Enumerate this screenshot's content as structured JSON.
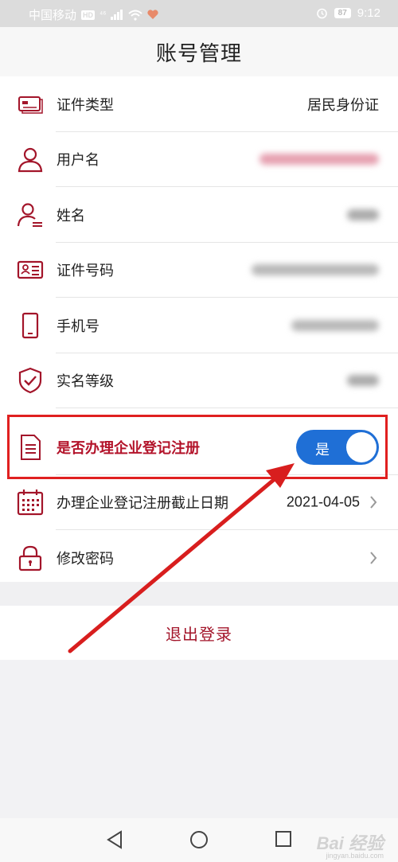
{
  "status_bar": {
    "carrier": "中国移动",
    "hd": "HD",
    "network": "⁴⁶",
    "battery": "87",
    "time": "9:12"
  },
  "header": {
    "title": "账号管理"
  },
  "rows": [
    {
      "label": "证件类型",
      "value": "居民身份证",
      "icon": "id-card-icon"
    },
    {
      "label": "用户名",
      "value": "",
      "icon": "user-icon"
    },
    {
      "label": "姓名",
      "value": "",
      "icon": "person-name-icon"
    },
    {
      "label": "证件号码",
      "value": "",
      "icon": "id-number-icon"
    },
    {
      "label": "手机号",
      "value": "",
      "icon": "phone-icon"
    },
    {
      "label": "实名等级",
      "value": "",
      "icon": "shield-check-icon"
    },
    {
      "label": "是否办理企业登记注册",
      "toggle_label": "是",
      "toggle_on": true,
      "icon": "document-icon"
    },
    {
      "label": "办理企业登记注册截止日期",
      "value": "2021-04-05",
      "icon": "calendar-icon"
    },
    {
      "label": "修改密码",
      "value": "",
      "icon": "lock-icon"
    }
  ],
  "logout": {
    "label": "退出登录"
  },
  "watermark": {
    "text": "Bai 经验",
    "sub": "jingyan.baidu.com"
  },
  "colors": {
    "accent_red": "#a3152a",
    "toggle_blue": "#1f6fd6",
    "highlight_border": "#e02020",
    "annotation_arrow": "#d81e1e"
  }
}
